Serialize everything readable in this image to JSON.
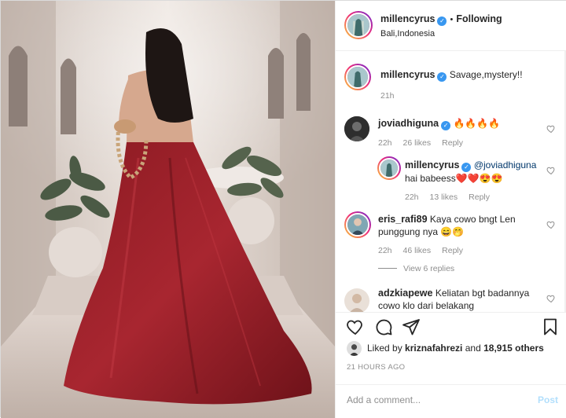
{
  "post": {
    "username": "millencyrus",
    "follow_label": "Following",
    "separator": "•",
    "location": "Bali,Indonesia"
  },
  "caption": {
    "username": "millencyrus",
    "text": "Savage,mystery!!",
    "time": "21h"
  },
  "comments": [
    {
      "username": "joviadhiguna",
      "text": "🔥🔥🔥🔥",
      "time": "22h",
      "likes": "26 likes",
      "reply": "Reply"
    },
    {
      "username": "millencyrus",
      "mention": "@joviadhiguna",
      "text": "hai babeess❤️❤️😍😍",
      "time": "22h",
      "likes": "13 likes",
      "reply": "Reply"
    },
    {
      "username": "eris_rafi89",
      "text": "Kaya cowo bngt Len punggung nya 😄🤭",
      "time": "22h",
      "likes": "46 likes",
      "reply": "Reply"
    },
    {
      "username": "adzkiapewe",
      "text": "Keliatan bgt badannya cowo klo dari belakang"
    }
  ],
  "view_replies": "View 6 replies",
  "likes_line": {
    "prefix": "Liked by ",
    "user": "kriznafahrezi",
    "middle": " and ",
    "count": "18,915 others"
  },
  "timestamp": "21 HOURS AGO",
  "add_comment": {
    "placeholder": "Add a comment...",
    "post": "Post"
  },
  "colors": {
    "accent": "#3897f0",
    "muted": "#8e8e8e",
    "post_disabled": "#b2dffc",
    "heart": "#ed4956"
  }
}
